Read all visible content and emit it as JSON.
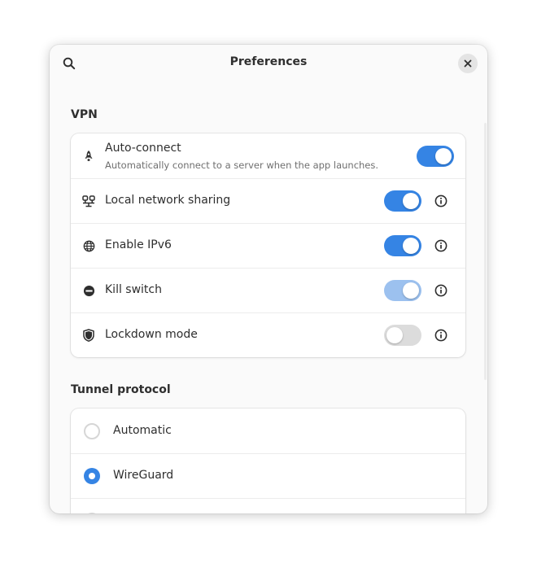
{
  "window": {
    "title": "Preferences"
  },
  "headerbar": {
    "search_icon": "search-icon",
    "close_icon": "close-icon"
  },
  "vpn": {
    "section_title": "VPN",
    "rows": [
      {
        "icon": "rocket-icon",
        "title": "Auto-connect",
        "subtitle": "Automatically connect to a server when the app launches.",
        "state": "on",
        "has_info": false
      },
      {
        "icon": "network-sharing-icon",
        "title": "Local network sharing",
        "state": "on",
        "has_info": true
      },
      {
        "icon": "globe-icon",
        "title": "Enable IPv6",
        "state": "on",
        "has_info": true
      },
      {
        "icon": "block-icon",
        "title": "Kill switch",
        "state": "on-dim",
        "has_info": true
      },
      {
        "icon": "shield-icon",
        "title": "Lockdown mode",
        "state": "off",
        "has_info": true
      }
    ]
  },
  "tunnel": {
    "section_title": "Tunnel protocol",
    "options": [
      {
        "label": "Automatic",
        "selected": false
      },
      {
        "label": "WireGuard",
        "selected": true
      }
    ]
  },
  "colors": {
    "accent": "#3584e4",
    "accent_dim": "#9cc1ef",
    "switch_off": "#dcdcdc",
    "window_bg": "#fafafa",
    "card_bg": "#ffffff"
  }
}
